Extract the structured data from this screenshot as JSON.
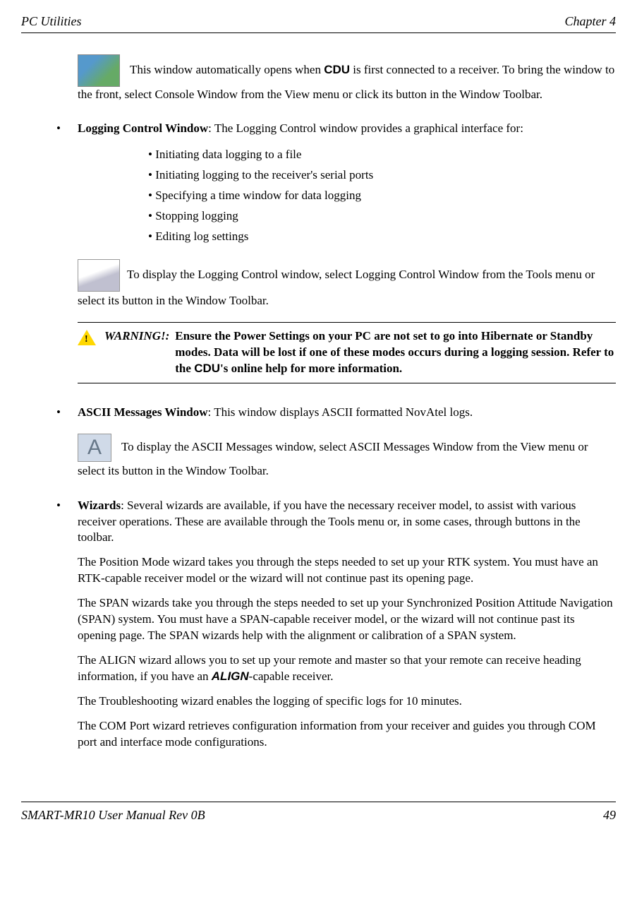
{
  "header": {
    "left": "PC Utilities",
    "right": "Chapter 4"
  },
  "p1": {
    "a": " This window automatically opens when ",
    "b": "CDU",
    "c": " is first connected to a receiver. To bring the window to the front, select Console Window from the View menu or click its button in the Window Toolbar."
  },
  "logging": {
    "title": "Logging Control Window",
    "desc": ": The Logging Control window provides a graphical interface for:",
    "items": [
      "• Initiating data logging to a file",
      "• Initiating logging to the receiver's serial ports",
      "• Specifying a time window for data logging",
      "• Stopping logging",
      "• Editing log settings"
    ],
    "tool": "To display the Logging Control window, select Logging Control Window from the Tools menu or select its button in the Window Toolbar."
  },
  "warning": {
    "label": "WARNING!:",
    "a": "Ensure the Power Settings on your PC are not set to go into Hibernate or Standby modes. Data will be lost if one of these modes occurs during a logging session. Refer to the ",
    "b": "CDU",
    "c": "'s online help for more information."
  },
  "ascii": {
    "title": "ASCII Messages Window",
    "desc": ": This window displays ASCII formatted NovAtel logs.",
    "tool": " To display the ASCII Messages window, select ASCII Messages Window from the View menu or select its button in the Window Toolbar."
  },
  "wizards": {
    "title": "Wizards",
    "desc": ": Several wizards are available, if you have the necessary receiver model, to assist with various receiver operations. These are available through the Tools menu or, in some cases, through buttons in the toolbar.",
    "p1": "The Position Mode wizard takes you through the steps needed to set up your RTK system. You must have an RTK-capable receiver model or the wizard will not continue past its opening page.",
    "p2": "The SPAN wizards take you through the steps needed to set up your Synchronized Position Attitude Navigation (SPAN) system. You must have a SPAN-capable receiver model, or the wizard will not continue past its opening page. The SPAN wizards help with the alignment or calibration of a SPAN system.",
    "p3a": "The ALIGN wizard allows you to set up your remote and master so that your remote can receive heading information, if you have an ",
    "p3b": "ALIGN",
    "p3c": "-capable receiver.",
    "p4": "The Troubleshooting wizard enables the logging of specific logs for 10 minutes.",
    "p5": "The COM Port wizard retrieves configuration information from your receiver and guides you through COM port and interface mode configurations."
  },
  "footer": {
    "left": "SMART-MR10 User Manual Rev 0B",
    "right": "49"
  }
}
